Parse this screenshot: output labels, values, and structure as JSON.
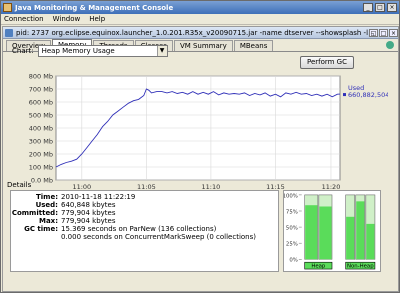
{
  "window": {
    "title": "Java Monitoring & Management Console",
    "buttons": [
      "_",
      "□",
      "×"
    ]
  },
  "menu": [
    "Connection",
    "Window",
    "Help"
  ],
  "connection": {
    "title": "pid: 2737 org.eclipse.equinox.launcher_1.0.201.R35x_v20090715.jar -name dtserver --showsplash -la...",
    "buttons": [
      "◱",
      "□",
      "×"
    ]
  },
  "tabs": [
    "Overview",
    "Memory",
    "Threads",
    "Classes",
    "VM Summary",
    "MBeans"
  ],
  "active_tab": "Memory",
  "chart_selector": {
    "label": "Chart:",
    "value": "Heap Memory Usage"
  },
  "gc_button": "Perform GC",
  "chart_data": {
    "type": "line",
    "ylim": [
      0,
      800
    ],
    "yticks": [
      "0.0 Mb",
      "100 Mb",
      "200 Mb",
      "300 Mb",
      "400 Mb",
      "500 Mb",
      "600 Mb",
      "700 Mb",
      "800 Mb"
    ],
    "xticks": [
      "11:00",
      "11:05",
      "11:10",
      "11:15",
      "11:20"
    ],
    "legend": {
      "name": "Used",
      "value": "660,882,504"
    },
    "series": [
      {
        "name": "Used",
        "points": [
          [
            0,
            100
          ],
          [
            0.4,
            120
          ],
          [
            0.8,
            135
          ],
          [
            1.2,
            145
          ],
          [
            1.6,
            160
          ],
          [
            2.0,
            200
          ],
          [
            2.4,
            250
          ],
          [
            2.8,
            300
          ],
          [
            3.2,
            350
          ],
          [
            3.6,
            410
          ],
          [
            4.0,
            450
          ],
          [
            4.4,
            500
          ],
          [
            4.8,
            530
          ],
          [
            5.2,
            560
          ],
          [
            5.6,
            590
          ],
          [
            6.0,
            610
          ],
          [
            6.4,
            620
          ],
          [
            6.8,
            650
          ],
          [
            7.0,
            700
          ],
          [
            7.2,
            690
          ],
          [
            7.4,
            670
          ],
          [
            7.8,
            680
          ],
          [
            8.2,
            680
          ],
          [
            8.6,
            670
          ],
          [
            9.0,
            680
          ],
          [
            9.4,
            665
          ],
          [
            9.8,
            675
          ],
          [
            10.2,
            660
          ],
          [
            10.6,
            680
          ],
          [
            11.0,
            660
          ],
          [
            11.4,
            675
          ],
          [
            11.8,
            660
          ],
          [
            12.2,
            680
          ],
          [
            12.6,
            655
          ],
          [
            13.0,
            670
          ],
          [
            13.4,
            660
          ],
          [
            13.8,
            665
          ],
          [
            14.2,
            660
          ],
          [
            14.6,
            670
          ],
          [
            15.0,
            650
          ],
          [
            15.4,
            665
          ],
          [
            15.8,
            655
          ],
          [
            16.2,
            670
          ],
          [
            16.6,
            645
          ],
          [
            17.0,
            660
          ],
          [
            17.4,
            640
          ],
          [
            17.8,
            670
          ],
          [
            18.2,
            660
          ],
          [
            18.6,
            675
          ],
          [
            19.0,
            660
          ],
          [
            19.4,
            665
          ],
          [
            19.8,
            650
          ],
          [
            20.2,
            660
          ],
          [
            20.6,
            645
          ],
          [
            21.0,
            660
          ],
          [
            21.4,
            640
          ],
          [
            21.8,
            660
          ],
          [
            22.0,
            661
          ]
        ]
      }
    ],
    "xrange": [
      0,
      22
    ]
  },
  "details": {
    "title": "Details",
    "rows": [
      {
        "label": "Time:",
        "value": "2010-11-18 11:22:19"
      },
      {
        "label": "Used:",
        "value": "640,848 kbytes"
      },
      {
        "label": "Committed:",
        "value": "779,904 kbytes"
      },
      {
        "label": "Max:",
        "value": "779,904 kbytes"
      },
      {
        "label": "GC time:",
        "value": "15.369  seconds on ParNew (136 collections)"
      },
      {
        "label": "",
        "value": "0.000  seconds on ConcurrentMarkSweep (0 collections)"
      }
    ]
  },
  "pools": {
    "yticks": [
      "100%",
      "75%",
      "50%",
      "25%",
      "0%"
    ],
    "heap": {
      "label": "Heap",
      "fills": [
        0.84,
        0.82
      ]
    },
    "nonheap": {
      "label": "Non-Heap",
      "fills": [
        0.66,
        0.9,
        0.55
      ]
    },
    "colors": {
      "used": "#5adc5a",
      "committed": "#d0f0c8",
      "border": "#6a6a6a"
    }
  }
}
